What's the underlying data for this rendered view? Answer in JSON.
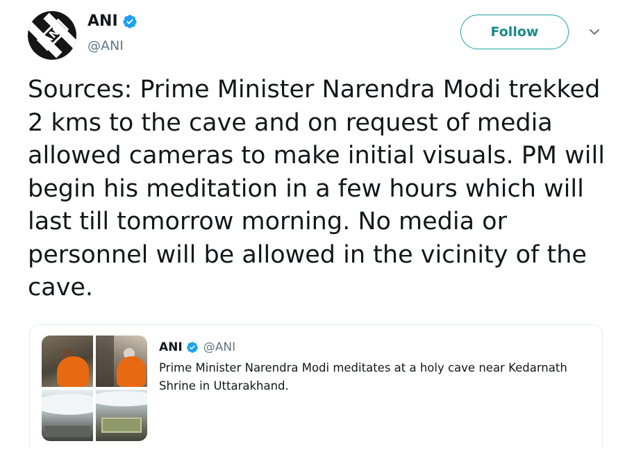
{
  "tweet": {
    "author": {
      "display_name": "ANI",
      "handle": "@ANI",
      "avatar_logo_text": "ANI",
      "verified": true,
      "verified_icon": "verified-badge-icon"
    },
    "follow_label": "Follow",
    "menu_icon": "chevron-down-icon",
    "text": "Sources: Prime Minister Narendra Modi trekked 2 kms to the cave and on request of media allowed cameras to make initial visuals. PM will begin his meditation in a few hours which will last till tomorrow morning. No media or personnel will be allowed in the vicinity of the cave."
  },
  "quoted_tweet": {
    "author": {
      "display_name": "ANI",
      "handle": "@ANI",
      "verified": true
    },
    "text": "Prime Minister Narendra Modi meditates at a holy cave near Kedarnath Shrine in Uttarakhand.",
    "media_count": 4
  },
  "colors": {
    "accent": "#1da1a1",
    "verified_blue": "#1da1f2",
    "robe_orange": "#e76a12",
    "secondary_text": "#657786"
  }
}
